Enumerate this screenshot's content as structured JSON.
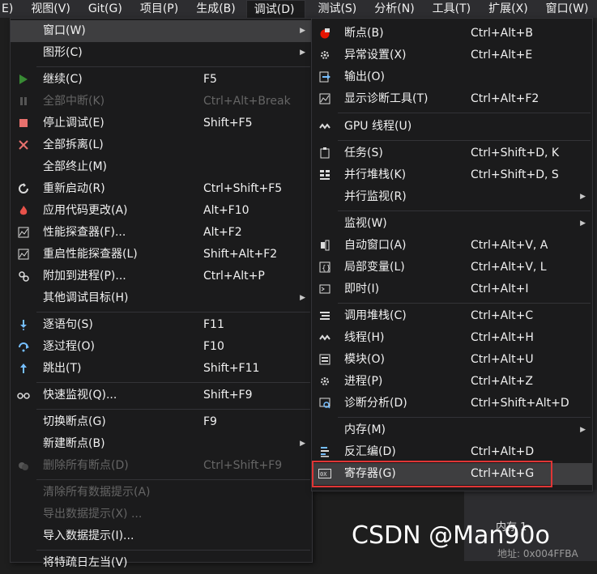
{
  "menubar": {
    "items": [
      {
        "label": "E)"
      },
      {
        "label": "视图(V)"
      },
      {
        "label": "Git(G)"
      },
      {
        "label": "项目(P)"
      },
      {
        "label": "生成(B)"
      },
      {
        "label": "调试(D)"
      },
      {
        "label": "测试(S)"
      },
      {
        "label": "分析(N)"
      },
      {
        "label": "工具(T)"
      },
      {
        "label": "扩展(X)"
      },
      {
        "label": "窗口(W)"
      }
    ]
  },
  "debug_menu": {
    "items": [
      {
        "label": "窗口(W)",
        "shortcut": "",
        "submenu": true,
        "icon": "none",
        "disabled": false
      },
      {
        "label": "图形(C)",
        "shortcut": "",
        "submenu": true,
        "icon": "none",
        "disabled": false
      },
      {
        "label": "继续(C)",
        "shortcut": "F5",
        "icon": "play-icon",
        "disabled": false
      },
      {
        "label": "全部中断(K)",
        "shortcut": "Ctrl+Alt+Break",
        "icon": "pause-icon",
        "disabled": true
      },
      {
        "label": "停止调试(E)",
        "shortcut": "Shift+F5",
        "icon": "stop-icon",
        "disabled": false
      },
      {
        "label": "全部拆离(L)",
        "shortcut": "",
        "icon": "detach-icon",
        "disabled": false
      },
      {
        "label": "全部终止(M)",
        "shortcut": "",
        "icon": "none",
        "disabled": false
      },
      {
        "label": "重新启动(R)",
        "shortcut": "Ctrl+Shift+F5",
        "icon": "restart-icon",
        "disabled": false
      },
      {
        "label": "应用代码更改(A)",
        "shortcut": "Alt+F10",
        "icon": "hot-reload-icon",
        "disabled": false
      },
      {
        "label": "性能探查器(F)...",
        "shortcut": "Alt+F2",
        "icon": "profiler-icon",
        "disabled": false
      },
      {
        "label": "重启性能探查器(L)",
        "shortcut": "Shift+Alt+F2",
        "icon": "profiler-icon",
        "disabled": false
      },
      {
        "label": "附加到进程(P)...",
        "shortcut": "Ctrl+Alt+P",
        "icon": "attach-icon",
        "disabled": false
      },
      {
        "label": "其他调试目标(H)",
        "shortcut": "",
        "submenu": true,
        "icon": "none",
        "disabled": false
      },
      {
        "label": "逐语句(S)",
        "shortcut": "F11",
        "icon": "step-into-icon",
        "disabled": false
      },
      {
        "label": "逐过程(O)",
        "shortcut": "F10",
        "icon": "step-over-icon",
        "disabled": false
      },
      {
        "label": "跳出(T)",
        "shortcut": "Shift+F11",
        "icon": "step-out-icon",
        "disabled": false
      },
      {
        "label": "快速监视(Q)...",
        "shortcut": "Shift+F9",
        "icon": "glasses-icon",
        "disabled": false
      },
      {
        "label": "切换断点(G)",
        "shortcut": "F9",
        "icon": "none",
        "disabled": false
      },
      {
        "label": "新建断点(B)",
        "shortcut": "",
        "submenu": true,
        "icon": "none",
        "disabled": false
      },
      {
        "label": "删除所有断点(D)",
        "shortcut": "Ctrl+Shift+F9",
        "icon": "delete-breakpoints-icon",
        "disabled": true
      },
      {
        "label": "清除所有数据提示(A)",
        "shortcut": "",
        "icon": "none",
        "disabled": true
      },
      {
        "label": "导出数据提示(X) ...",
        "shortcut": "",
        "icon": "none",
        "disabled": true
      },
      {
        "label": "导入数据提示(I)...",
        "shortcut": "",
        "icon": "none",
        "disabled": false
      },
      {
        "label": "将特疏日左当(V)",
        "shortcut": "",
        "icon": "none",
        "disabled": false
      }
    ]
  },
  "window_submenu": {
    "items": [
      {
        "label": "断点(B)",
        "shortcut": "Ctrl+Alt+B",
        "icon": "breakpoint-icon"
      },
      {
        "label": "异常设置(X)",
        "shortcut": "Ctrl+Alt+E",
        "icon": "exception-icon"
      },
      {
        "label": "输出(O)",
        "shortcut": "",
        "icon": "output-icon"
      },
      {
        "label": "显示诊断工具(T)",
        "shortcut": "Ctrl+Alt+F2",
        "icon": "diagnostics-icon"
      },
      {
        "label": "GPU 线程(U)",
        "shortcut": "",
        "icon": "threads-icon"
      },
      {
        "label": "任务(S)",
        "shortcut": "Ctrl+Shift+D, K",
        "icon": "tasks-icon"
      },
      {
        "label": "并行堆栈(K)",
        "shortcut": "Ctrl+Shift+D, S",
        "icon": "parallel-stacks-icon"
      },
      {
        "label": "并行监视(R)",
        "shortcut": "",
        "submenu": true,
        "icon": "none"
      },
      {
        "label": "监视(W)",
        "shortcut": "",
        "submenu": true,
        "icon": "none"
      },
      {
        "label": "自动窗口(A)",
        "shortcut": "Ctrl+Alt+V, A",
        "icon": "autos-icon"
      },
      {
        "label": "局部变量(L)",
        "shortcut": "Ctrl+Alt+V, L",
        "icon": "locals-icon"
      },
      {
        "label": "即时(I)",
        "shortcut": "Ctrl+Alt+I",
        "icon": "immediate-icon"
      },
      {
        "label": "调用堆栈(C)",
        "shortcut": "Ctrl+Alt+C",
        "icon": "call-stack-icon"
      },
      {
        "label": "线程(H)",
        "shortcut": "Ctrl+Alt+H",
        "icon": "threads-icon"
      },
      {
        "label": "模块(O)",
        "shortcut": "Ctrl+Alt+U",
        "icon": "modules-icon"
      },
      {
        "label": "进程(P)",
        "shortcut": "Ctrl+Alt+Z",
        "icon": "processes-icon"
      },
      {
        "label": "诊断分析(D)",
        "shortcut": "Ctrl+Shift+Alt+D",
        "icon": "diagnostic-analysis-icon"
      },
      {
        "label": "内存(M)",
        "shortcut": "",
        "submenu": true,
        "icon": "none"
      },
      {
        "label": "反汇编(D)",
        "shortcut": "Ctrl+Alt+D",
        "icon": "disassembly-icon"
      },
      {
        "label": "寄存器(G)",
        "shortcut": "Ctrl+Alt+G",
        "icon": "registers-icon"
      }
    ]
  },
  "background": {
    "memory_label": "内存 1",
    "address_text": "地址: 0x004FFBA"
  },
  "watermark": "CSDN @Man90o",
  "colors": {
    "highlight_box": "#e03535",
    "menu_bg": "#1b1b1c",
    "hover_bg": "#3e3e40"
  }
}
